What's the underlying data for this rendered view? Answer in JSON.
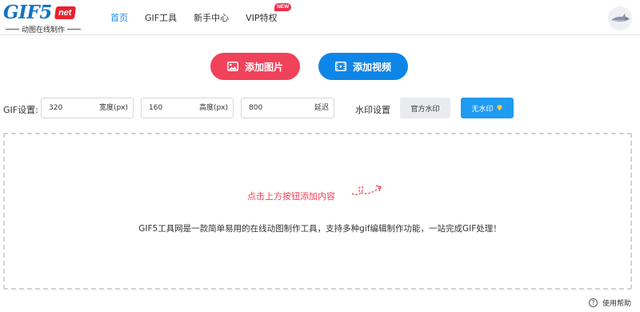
{
  "logo": {
    "main": "GIF5",
    "net": "net",
    "subtitle": "动图在线制作"
  },
  "nav": [
    {
      "label": "首页",
      "active": true
    },
    {
      "label": "GIF工具",
      "active": false
    },
    {
      "label": "新手中心",
      "active": false
    },
    {
      "label": "VIP特权",
      "active": false,
      "badge": "NEW"
    }
  ],
  "buttons": {
    "add_image": "添加图片",
    "add_video": "添加视频"
  },
  "settings": {
    "label": "GIF设置:",
    "width": {
      "value": "320",
      "unit": "宽度(px)"
    },
    "height": {
      "value": "160",
      "unit": "高度(px)"
    },
    "delay": {
      "value": "800",
      "unit": "延迟"
    },
    "watermark_label": "水印设置",
    "watermark_official": "官方水印",
    "watermark_none": "无水印"
  },
  "drop": {
    "hint": "点击上方按钮添加内容",
    "description": "GIF5工具网是一款简单易用的在线动图制作工具，支持多种gif编辑制作功能，一站完成GIF处理！"
  },
  "help": {
    "label": "使用帮助",
    "icon": "question-icon"
  },
  "colors": {
    "accent_blue": "#0e86e8",
    "accent_red": "#f0425a",
    "nav_active": "#1a8cf0"
  }
}
